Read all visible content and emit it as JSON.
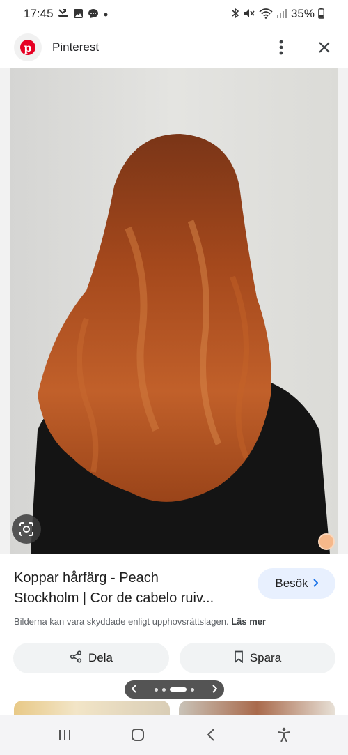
{
  "status_bar": {
    "time": "17:45",
    "battery": "35%"
  },
  "app_bar": {
    "site_name": "Pinterest"
  },
  "result": {
    "title_line1": "Koppar hårfärg - Peach",
    "title_line2": "Stockholm | Cor de cabelo ruiv...",
    "visit_label": "Besök",
    "copyright_text": "Bilderna kan vara skyddade enligt upphovsrättslagen.",
    "learn_more": "Läs mer",
    "share_label": "Dela",
    "save_label": "Spara"
  },
  "colors": {
    "pinterest_red": "#e60023",
    "visit_bg": "#e8f0fe",
    "accent_blue": "#1a73e8",
    "hair_copper": "#b5531f"
  },
  "icons": {
    "status_left": [
      "missed-call-icon",
      "gallery-icon",
      "chat-icon",
      "dot-icon"
    ],
    "status_right": [
      "bluetooth-icon",
      "mute-icon",
      "wifi-icon",
      "signal-icon",
      "battery-icon"
    ],
    "app_bar": [
      "pinterest-logo",
      "more-vert-icon",
      "close-icon"
    ],
    "nav": [
      "recents-icon",
      "home-icon",
      "back-icon",
      "accessibility-icon"
    ]
  }
}
